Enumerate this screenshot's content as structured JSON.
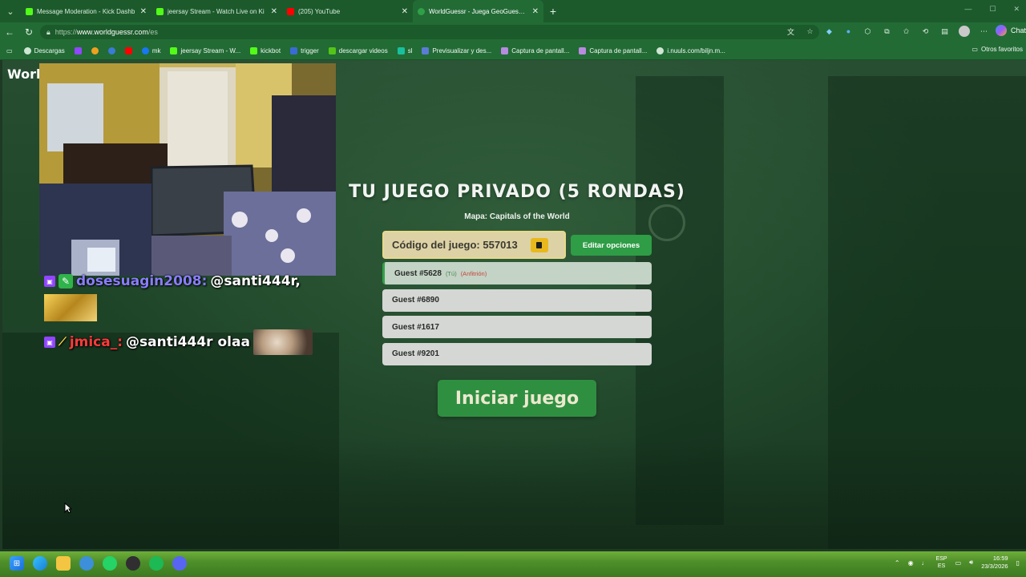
{
  "browser": {
    "tabs": [
      {
        "title": "Message Moderation - Kick Dashb",
        "favicon_color": "#53fc18",
        "active": false
      },
      {
        "title": "jeersay Stream - Watch Live on Ki",
        "favicon_color": "#53fc18",
        "active": false
      },
      {
        "title": "(205) YouTube",
        "favicon_color": "#ff0000",
        "active": false
      },
      {
        "title": "WorldGuessr - Juega GeoGuessr g",
        "favicon_color": "#2fa046",
        "active": true
      }
    ],
    "new_tab_label": "+",
    "url_prefix": "https://",
    "url_domain": "www.worldguessr.com",
    "url_path": "/es",
    "chat_label": "Chat",
    "bookmarks": [
      {
        "label": "Descargas",
        "icon": "globe-icon",
        "color": "#cfe6d3"
      },
      {
        "label": "",
        "icon": "twitch-icon",
        "color": "#9146ff"
      },
      {
        "label": "",
        "icon": "bookmark-icon",
        "color": "#f0a020"
      },
      {
        "label": "",
        "icon": "bookmark-icon",
        "color": "#3a7bd5"
      },
      {
        "label": "",
        "icon": "youtube-icon",
        "color": "#ff0000"
      },
      {
        "label": "mk",
        "icon": "facebook-icon",
        "color": "#1877f2"
      },
      {
        "label": "jeersay Stream - W...",
        "icon": "kick-icon",
        "color": "#53fc18"
      },
      {
        "label": "kickbot",
        "icon": "kick-icon",
        "color": "#53fc18"
      },
      {
        "label": "trigger",
        "icon": "bookmark-icon",
        "color": "#3a6bd5"
      },
      {
        "label": "descargar videos",
        "icon": "download-icon",
        "color": "#53c518"
      },
      {
        "label": "sl",
        "icon": "bookmark-icon",
        "color": "#18c0a0"
      },
      {
        "label": "Previsualizar y des...",
        "icon": "bookmark-icon",
        "color": "#5b7bd5"
      },
      {
        "label": "Captura de pantall...",
        "icon": "pen-icon",
        "color": "#b78be0"
      },
      {
        "label": "Captura de pantall...",
        "icon": "pen-icon",
        "color": "#b78be0"
      },
      {
        "label": "i.nuuls.com/biljn.m...",
        "icon": "globe-icon",
        "color": "#cfe6d3"
      }
    ],
    "other_favorites": "Otros favoritos"
  },
  "page": {
    "logo": "World",
    "chat_messages": [
      {
        "user": "dosesuagin2008:",
        "user_color": "#8a7dff",
        "text": "@santi444r,"
      },
      {
        "user": "jmica_:",
        "user_color": "#ff3b3b",
        "text": "@santi444r olaa"
      }
    ],
    "lobby": {
      "title": "TU JUEGO PRIVADO (5 RONDAS)",
      "map_label": "Mapa: Capitals of the World",
      "code_label": "Código del juego: 557013",
      "edit_options": "Editar opciones",
      "players": [
        {
          "name": "Guest #5628",
          "you": "(Tú)",
          "host": "(Anfitrión)"
        },
        {
          "name": "Guest #6890"
        },
        {
          "name": "Guest #1617"
        },
        {
          "name": "Guest #9201"
        }
      ],
      "start_button": "Iniciar juego"
    }
  },
  "taskbar": {
    "lang_top": "ESP",
    "lang_bottom": "ES",
    "time": "16:59",
    "date": "23/3/2026"
  }
}
